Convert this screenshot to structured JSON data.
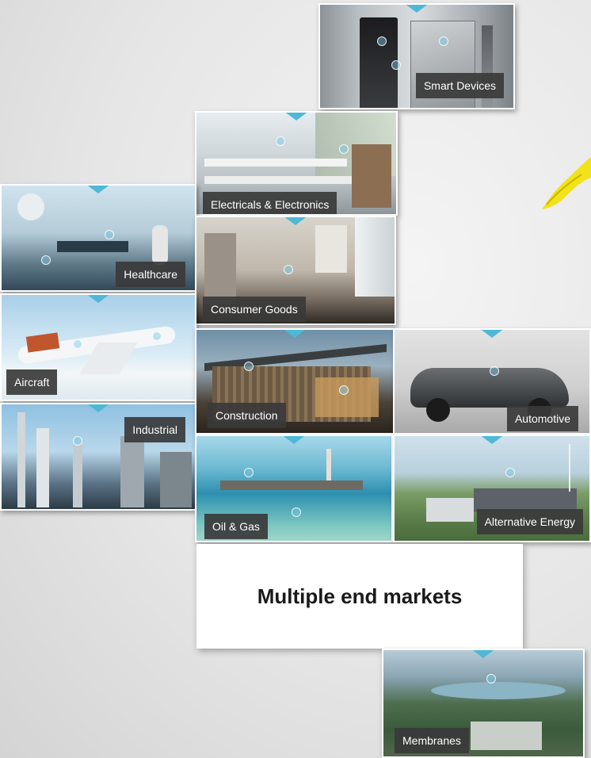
{
  "tiles": {
    "smart_devices": "Smart Devices",
    "electricals": "Electricals & Electronics",
    "healthcare": "Healthcare",
    "consumer_goods": "Consumer Goods",
    "aircraft": "Aircraft",
    "industrial": "Industrial",
    "construction": "Construction",
    "automotive": "Automotive",
    "oil_gas": "Oil & Gas",
    "alternative_energy": "Alternative Energy",
    "membranes": "Membranes"
  },
  "caption": "Multiple end markets",
  "colors": {
    "marker": "#4fb8d6",
    "label_bg": "#3a3a3a",
    "accent_swoosh": "#f2e21a"
  }
}
